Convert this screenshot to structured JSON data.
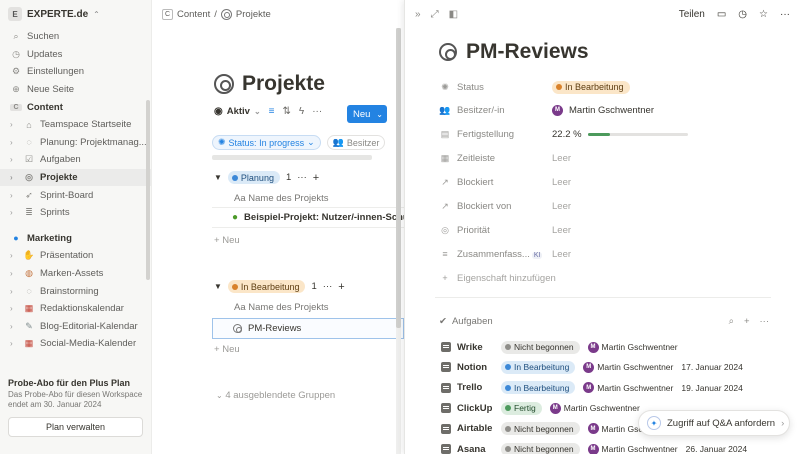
{
  "sidebar": {
    "workspace_logo": "E",
    "workspace_name": "EXPERTE.de",
    "top_items": [
      {
        "label": "Suchen",
        "icon": "search-icon"
      },
      {
        "label": "Updates",
        "icon": "clock-icon"
      },
      {
        "label": "Einstellungen",
        "icon": "gear-icon"
      },
      {
        "label": "Neue Seite",
        "icon": "plus-icon"
      }
    ],
    "content_section": {
      "logo": "C",
      "label": "Content"
    },
    "content_items": [
      {
        "label": "Teamspace Startseite",
        "icon": "home-icon"
      },
      {
        "label": "Planung: Projektmanag...",
        "icon": "chat-icon"
      },
      {
        "label": "Aufgaben",
        "icon": "checkbox-icon"
      },
      {
        "label": "Projekte",
        "icon": "target-icon"
      },
      {
        "label": "Sprint-Board",
        "icon": "rocket-icon"
      },
      {
        "label": "Sprints",
        "icon": "stack-icon"
      }
    ],
    "marketing_section": {
      "label": "Marketing"
    },
    "marketing_items": [
      {
        "label": "Präsentation",
        "icon": "hands-icon"
      },
      {
        "label": "Marken-Assets",
        "icon": "palette-icon"
      },
      {
        "label": "Brainstorming",
        "icon": "chat-icon"
      },
      {
        "label": "Redaktionskalendar",
        "icon": "calendar-icon"
      },
      {
        "label": "Blog-Editorial-Kalendar",
        "icon": "pencil-icon"
      },
      {
        "label": "Social-Media-Kalender",
        "icon": "calendar-icon"
      }
    ],
    "promo": {
      "title": "Probe-Abo für den Plus Plan",
      "text": "Das Probe-Abo für diesen Workspace endet am 30. Januar 2024",
      "button": "Plan verwalten"
    }
  },
  "main": {
    "breadcrumb": {
      "logo": "C",
      "root": "Content",
      "separator": "/",
      "current": "Projekte"
    },
    "title": "Projekte",
    "view_label": "Aktiv",
    "new_button": "Neu",
    "filter_chip": "Status: In progress",
    "filter_chip2": "Besitzer",
    "groups": [
      {
        "status": "Planung",
        "count": "1",
        "column_header": "Name des Projekts",
        "rows": [
          {
            "name": "Beispiel-Projekt: Nutzer/-innen-Schul"
          }
        ],
        "add_label": "Neu"
      },
      {
        "status": "In Bearbeitung",
        "count": "1",
        "column_header": "Name des Projekts",
        "rows": [
          {
            "name": "PM-Reviews"
          }
        ],
        "add_label": "Neu"
      }
    ],
    "hidden_groups": "4 ausgeblendete Gruppen",
    "column_prefix": "Aa"
  },
  "panel": {
    "share_label": "Teilen",
    "title": "PM-Reviews",
    "properties": [
      {
        "label": "Status",
        "value": "In Bearbeitung",
        "icon": "status-icon",
        "type": "status"
      },
      {
        "label": "Besitzer/-in",
        "value": "Martin Gschwentner",
        "icon": "people-icon",
        "type": "person",
        "avatar": "M"
      },
      {
        "label": "Fertigstellung",
        "value": "22.2 %",
        "progress": 22.2,
        "icon": "progress-icon",
        "type": "progress"
      },
      {
        "label": "Zeitleiste",
        "value": "Leer",
        "icon": "calendar-icon",
        "type": "empty"
      },
      {
        "label": "Blockiert",
        "value": "Leer",
        "icon": "arrow-icon",
        "type": "empty"
      },
      {
        "label": "Blockiert von",
        "value": "Leer",
        "icon": "arrow-icon",
        "type": "empty"
      },
      {
        "label": "Priorität",
        "value": "Leer",
        "icon": "priority-icon",
        "type": "empty"
      },
      {
        "label": "Zusammenfass...",
        "value": "Leer",
        "icon": "doc-icon",
        "type": "empty",
        "badge": "KI"
      }
    ],
    "add_property": "Eigenschaft hinzufügen",
    "tasks_label": "Aufgaben",
    "tasks": [
      {
        "name": "Wrike",
        "status": "Nicht begonnen",
        "color": "grey",
        "person": "Martin Gschwentner",
        "date": ""
      },
      {
        "name": "Notion",
        "status": "In Bearbeitung",
        "color": "blue",
        "person": "Martin Gschwentner",
        "date": "17. Januar 2024"
      },
      {
        "name": "Trello",
        "status": "In Bearbeitung",
        "color": "blue",
        "person": "Martin Gschwentner",
        "date": "19. Januar 2024"
      },
      {
        "name": "ClickUp",
        "status": "Fertig",
        "color": "green",
        "person": "Martin Gschwentner",
        "date": ""
      },
      {
        "name": "Airtable",
        "status": "Nicht begonnen",
        "color": "grey",
        "person": "Martin Gschwentner",
        "date": ""
      },
      {
        "name": "Asana",
        "status": "Nicht begonnen",
        "color": "grey",
        "person": "Martin Gschwentner",
        "date": "26. Januar 2024"
      }
    ]
  },
  "qa_button": "Zugriff auf Q&A anfordern"
}
